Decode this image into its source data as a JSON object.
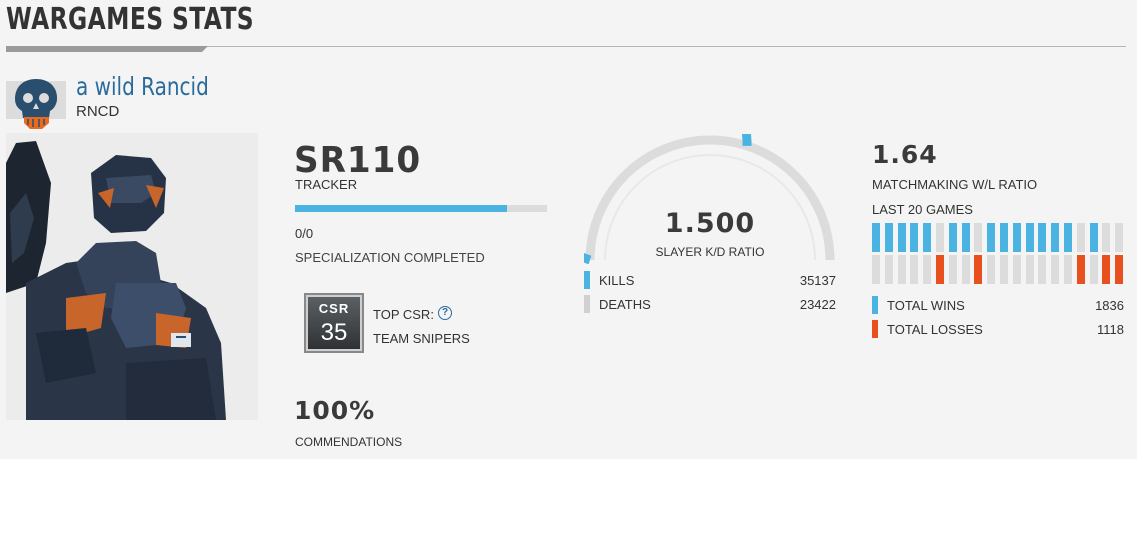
{
  "header": {
    "title": "WARGAMES STATS"
  },
  "player": {
    "gamertag": "a wild Rancid",
    "service_tag": "RNCD",
    "emblem_icon": "skull-emblem-icon"
  },
  "spartan_rank": {
    "value": "SR110",
    "label": "TRACKER",
    "progress": 0.84
  },
  "specialization": {
    "count": "0/0",
    "label": "SPECIALIZATION COMPLETED"
  },
  "csr": {
    "badge_text": "CSR",
    "badge_value": "35",
    "label": "TOP CSR:",
    "playlist": "TEAM SNIPERS",
    "help_icon": "question-circle-icon"
  },
  "commendations": {
    "value": "100%",
    "label": "COMMENDATIONS"
  },
  "kd": {
    "value": "1.500",
    "label": "SLAYER K/D RATIO",
    "fraction": 0.6,
    "kills_label": "KILLS",
    "kills": "35137",
    "deaths_label": "DEATHS",
    "deaths": "23422"
  },
  "wl": {
    "value": "1.64",
    "label": "MATCHMAKING W/L RATIO",
    "last20_label": "LAST 20 GAMES",
    "last20": [
      "W",
      "W",
      "W",
      "W",
      "W",
      "L",
      "W",
      "W",
      "L",
      "W",
      "W",
      "W",
      "W",
      "W",
      "W",
      "W",
      "L",
      "W",
      "L",
      "L"
    ],
    "wins_label": "TOTAL WINS",
    "wins": "1836",
    "losses_label": "TOTAL LOSSES",
    "losses": "1118"
  },
  "colors": {
    "win": "#4ab3e2",
    "loss": "#e8501e",
    "neutral": "#dcdcdc",
    "accent_blue": "#2a6b9c"
  }
}
